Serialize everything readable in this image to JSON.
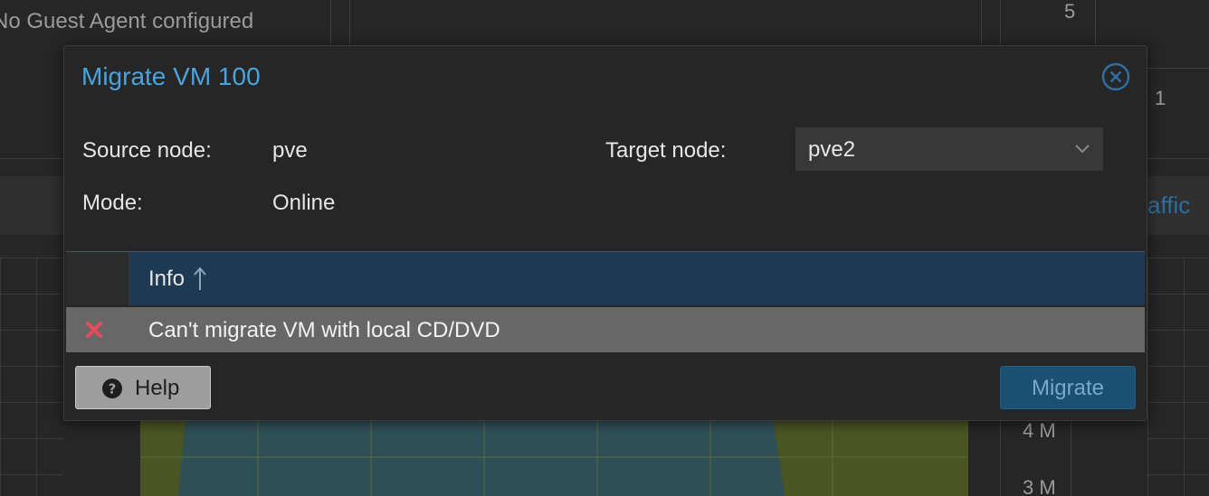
{
  "background": {
    "guest_agent_text": "No Guest Agent configured",
    "axis_labels": [
      "5",
      "4 M",
      "3 M"
    ],
    "partial_label_1": "1",
    "partial_tab": "affic"
  },
  "dialog": {
    "title": "Migrate VM 100",
    "close_icon": "close-circle-icon",
    "source_node_label": "Source node:",
    "source_node_value": "pve",
    "mode_label": "Mode:",
    "mode_value": "Online",
    "target_node_label": "Target node:",
    "target_node_value": "pve2",
    "grid": {
      "columns": [
        "Info"
      ],
      "sort": "ascending",
      "rows": [
        {
          "status_icon": "error-x-icon",
          "info": "Can't migrate VM with local CD/DVD"
        }
      ]
    },
    "help_button": "Help",
    "migrate_button": "Migrate",
    "colors": {
      "title": "#4aa3df",
      "header": "#1e3a52",
      "error": "#e84a5a",
      "migrate_button": "#1b4f73"
    }
  }
}
